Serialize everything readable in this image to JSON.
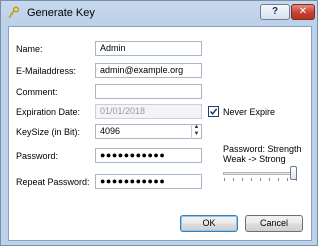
{
  "window": {
    "title": "Generate Key",
    "help_label": "?",
    "close_label": "✕"
  },
  "form": {
    "name": {
      "label": "Name:",
      "value": "Admin"
    },
    "email": {
      "label": "E-Mailaddress:",
      "value": "admin@example.org"
    },
    "comment": {
      "label": "Comment:",
      "value": ""
    },
    "expiration": {
      "label": "Expiration Date:",
      "value": "01/01/2018"
    },
    "never_expire": {
      "label": "Never Expire",
      "checked": true
    },
    "keysize": {
      "label": "KeySize (in Bit):",
      "value": "4096"
    },
    "password": {
      "label": "Password:",
      "value": "●●●●●●●●●●●"
    },
    "repeat_password": {
      "label": "Repeat Password:",
      "value": "●●●●●●●●●●●"
    },
    "strength": {
      "label_line1": "Password: Strength",
      "label_line2": "Weak -> Strong",
      "level_fraction": 1.0
    }
  },
  "buttons": {
    "ok": "OK",
    "cancel": "Cancel"
  },
  "icons": {
    "window": "key-icon",
    "check": "checkmark-icon",
    "spin_up": "chevron-up-icon",
    "spin_down": "chevron-down-icon"
  }
}
